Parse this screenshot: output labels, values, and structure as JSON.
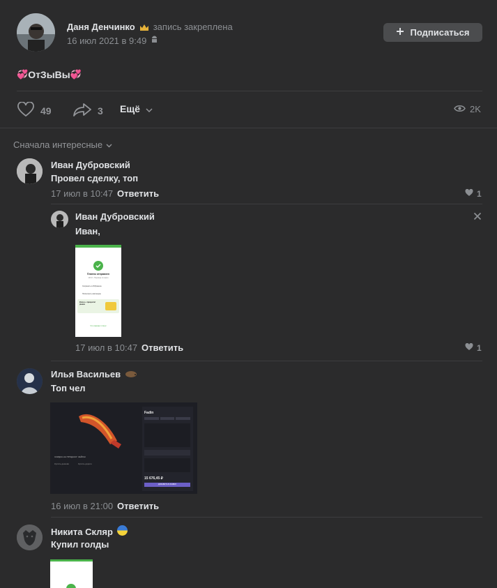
{
  "post": {
    "author": "Даня Денчинко",
    "crown_icon": "crown-icon",
    "pinned": "запись закреплена",
    "date": "16 июл 2021 в 9:49",
    "subscribe": "Подписаться",
    "text_prefix": "💞",
    "text": "ОтЗыВы",
    "text_suffix": "💞",
    "likes": "49",
    "shares": "3",
    "more": "Ещё",
    "views": "2K"
  },
  "comments_sort": "Сначала интересные",
  "comments": [
    {
      "author": "Иван Дубровский",
      "text": "Провел сделку, топ",
      "date": "17 июл в 10:47",
      "reply": "Ответить",
      "likes": "1"
    },
    {
      "author": "Иван Дубровский",
      "text": "Иван,",
      "date": "17 июл в 10:47",
      "reply": "Ответить",
      "likes": "1"
    },
    {
      "author": "Илья Васильев",
      "text": "Топ чел",
      "date": "16 июл в 21:00",
      "reply": "Ответить"
    },
    {
      "author": "Никита Скляр",
      "text": "Купил голды"
    }
  ],
  "screenshot1": {
    "title": "Платеж отправлен",
    "sub": "140 ₽ • Перевод по карте",
    "row1": "Сохранить в Избранное",
    "row2": "Посмотреть квитанцию",
    "promo": "Купон + приоритет рынка",
    "link": "Что означает статус"
  },
  "screenshot2": {
    "header": "Fadin",
    "amount": "15 676,45 ₽",
    "button": "ДОБАВИТЬ В ЗАЯВКУ",
    "left1": "СКИДКА НА ПРОДАЖУ",
    "left2": "КЕЙСЫ",
    "left3": "Купить дешево",
    "left4": "Купить дорого"
  },
  "colors": {
    "bg": "#2b2b2c",
    "accent_green": "#4bb34b",
    "purple": "#6c5fc7"
  }
}
